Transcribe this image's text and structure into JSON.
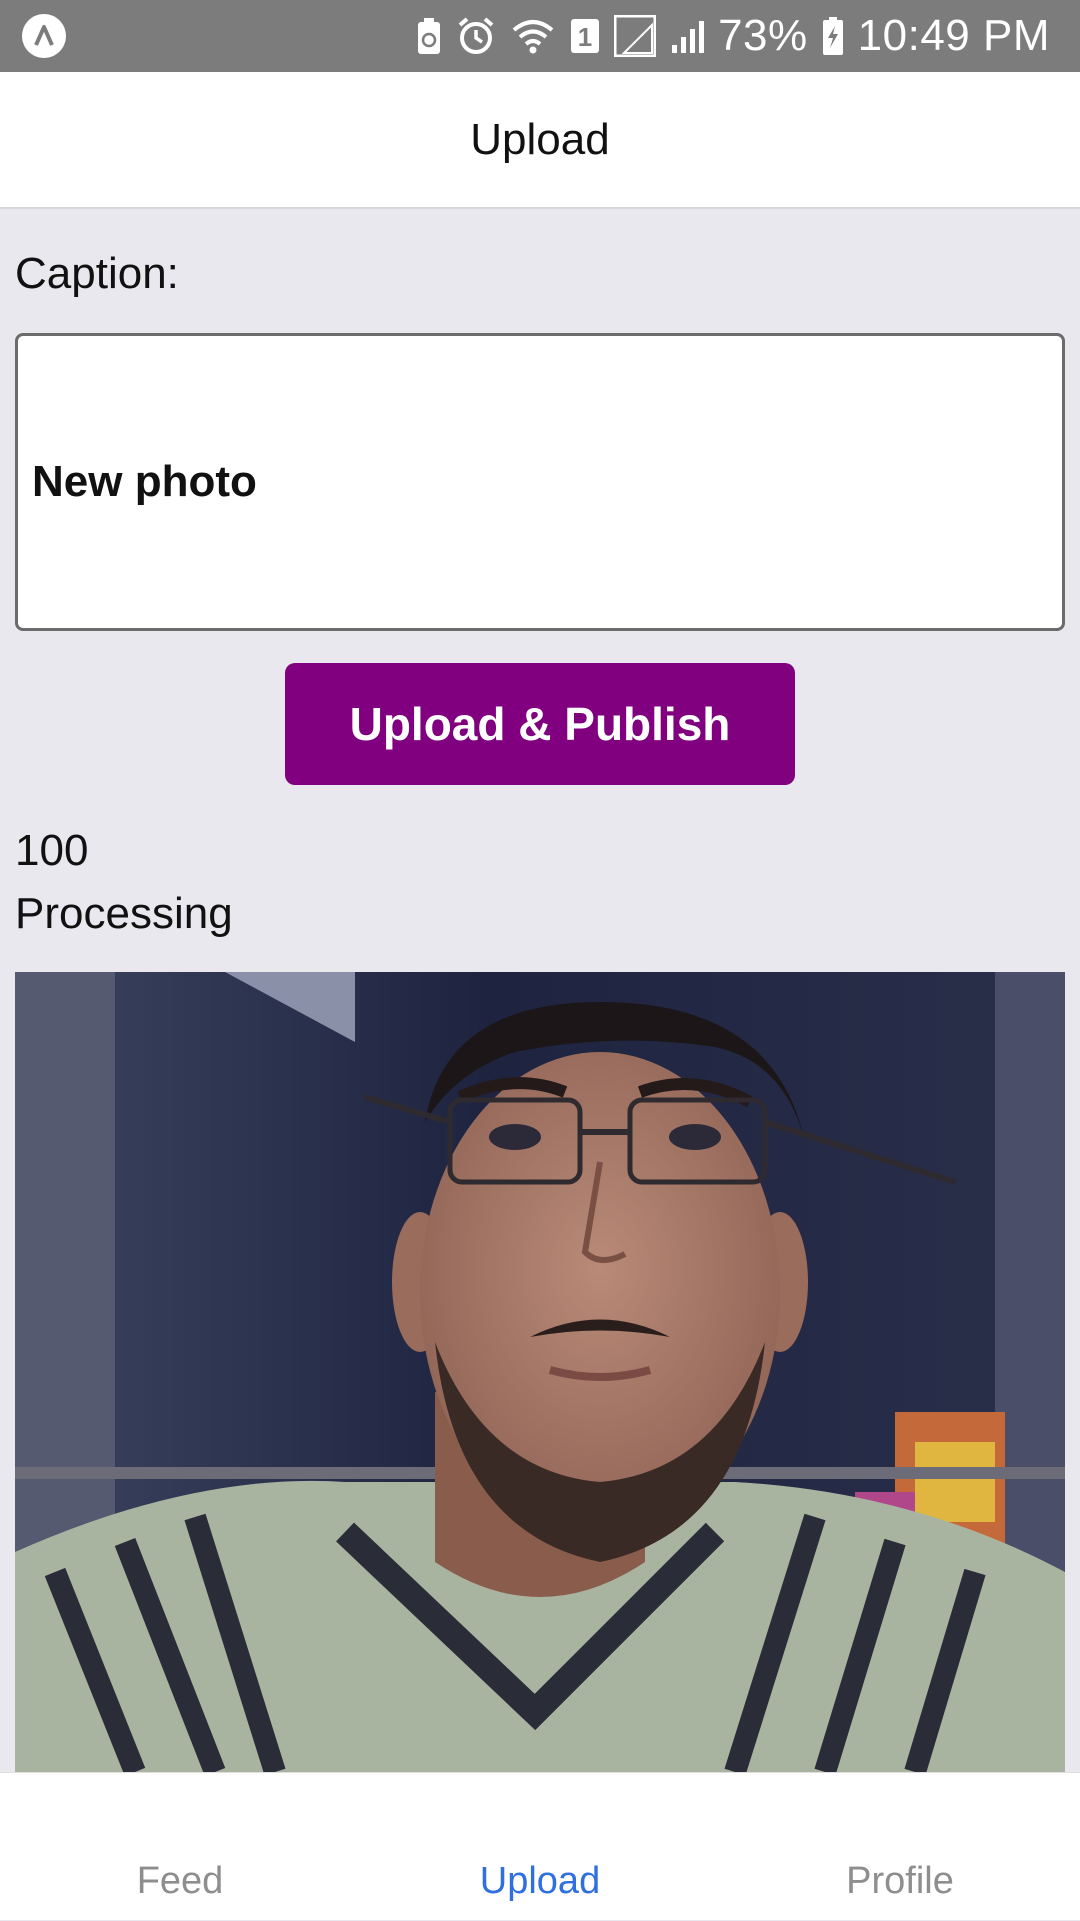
{
  "status_bar": {
    "battery_percent": "73%",
    "time": "10:49 PM",
    "sim_badge": "1",
    "icons": [
      "android-logo-icon",
      "recycle-notification-icon",
      "alarm-icon",
      "wifi-icon",
      "sim-1-icon",
      "signal-r-icon",
      "signal-icon",
      "battery-charging-icon"
    ]
  },
  "header": {
    "title": "Upload"
  },
  "form": {
    "caption_label": "Caption:",
    "caption_value": "New photo",
    "publish_label": "Upload & Publish",
    "progress_value": "100",
    "progress_status": "Processing"
  },
  "colors": {
    "primary_button": "#800080",
    "active_tab": "#2f6fe0",
    "inactive_tab": "#8e8e8e",
    "page_background": "#e9e8ef",
    "status_bar": "#7c7c7c"
  },
  "tabs": [
    {
      "label": "Feed",
      "active": false
    },
    {
      "label": "Upload",
      "active": true
    },
    {
      "label": "Profile",
      "active": false
    }
  ]
}
